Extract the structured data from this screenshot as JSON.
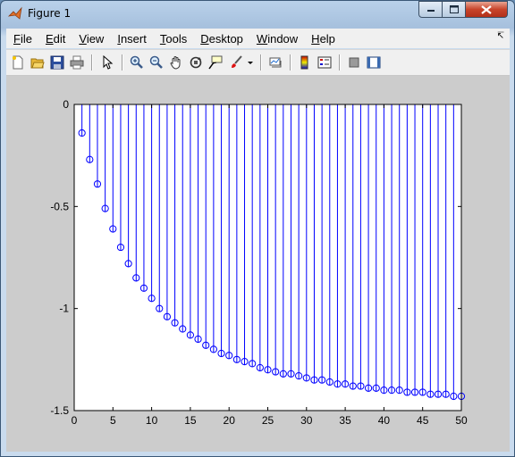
{
  "window": {
    "title": "Figure 1"
  },
  "menubar": {
    "items": [
      "File",
      "Edit",
      "View",
      "Insert",
      "Tools",
      "Desktop",
      "Window",
      "Help"
    ],
    "overflow_icon": "dock-arrow-icon"
  },
  "toolbar": {
    "buttons": [
      "new-figure-icon",
      "open-file-icon",
      "save-icon",
      "print-icon",
      "edit-plot-arrow-icon",
      "zoom-in-icon",
      "zoom-out-icon",
      "pan-hand-icon",
      "rotate-3d-icon",
      "data-cursor-icon",
      "brush-icon",
      "link-plot-icon",
      "colorbar-icon",
      "legend-icon",
      "hide-plot-tools-icon",
      "show-plot-tools-icon"
    ]
  },
  "colors": {
    "stem": "#0000ff",
    "figure_bg": "#cccccc",
    "axes_bg": "#ffffff"
  },
  "chart_data": {
    "type": "stem",
    "title": "",
    "xlabel": "",
    "ylabel": "",
    "xlim": [
      0,
      50
    ],
    "ylim": [
      -1.5,
      0
    ],
    "grid": false,
    "xticks": [
      0,
      5,
      10,
      15,
      20,
      25,
      30,
      35,
      40,
      45,
      50
    ],
    "xtick_labels": [
      "0",
      "5",
      "10",
      "15",
      "20",
      "25",
      "30",
      "35",
      "40",
      "45",
      "50"
    ],
    "yticks": [
      0,
      -0.5,
      -1,
      -1.5
    ],
    "ytick_labels": [
      "0",
      "-0.5",
      "-1",
      "-1.5"
    ],
    "x": [
      1,
      2,
      3,
      4,
      5,
      6,
      7,
      8,
      9,
      10,
      11,
      12,
      13,
      14,
      15,
      16,
      17,
      18,
      19,
      20,
      21,
      22,
      23,
      24,
      25,
      26,
      27,
      28,
      29,
      30,
      31,
      32,
      33,
      34,
      35,
      36,
      37,
      38,
      39,
      40,
      41,
      42,
      43,
      44,
      45,
      46,
      47,
      48,
      49,
      50
    ],
    "y": [
      -0.14,
      -0.27,
      -0.39,
      -0.51,
      -0.61,
      -0.7,
      -0.78,
      -0.85,
      -0.9,
      -0.95,
      -1.0,
      -1.04,
      -1.07,
      -1.1,
      -1.13,
      -1.15,
      -1.18,
      -1.2,
      -1.22,
      -1.23,
      -1.25,
      -1.26,
      -1.27,
      -1.29,
      -1.3,
      -1.31,
      -1.32,
      -1.32,
      -1.33,
      -1.34,
      -1.35,
      -1.35,
      -1.36,
      -1.37,
      -1.37,
      -1.38,
      -1.38,
      -1.39,
      -1.39,
      -1.4,
      -1.4,
      -1.4,
      -1.41,
      -1.41,
      -1.41,
      -1.42,
      -1.42,
      -1.42,
      -1.43,
      -1.43
    ]
  }
}
